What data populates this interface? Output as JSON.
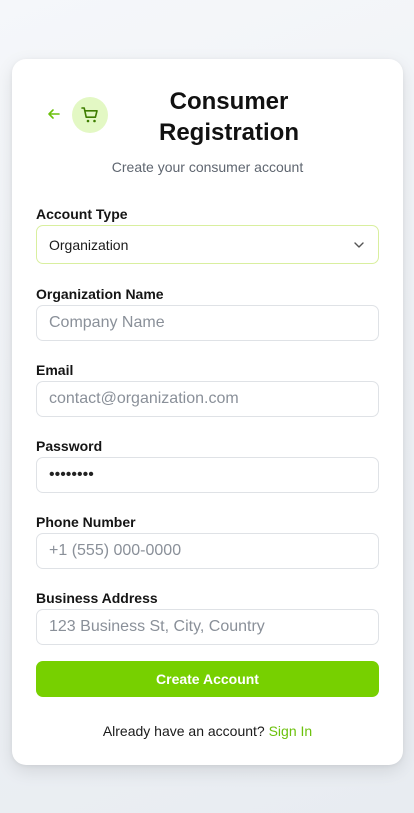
{
  "header": {
    "title": "Consumer Registration",
    "subtitle": "Create your consumer account",
    "back_icon": "arrow-left-icon",
    "logo_icon": "shopping-cart-icon",
    "accent_color": "#77d000"
  },
  "form": {
    "account_type": {
      "label": "Account Type",
      "value": "Organization"
    },
    "organization_name": {
      "label": "Organization Name",
      "placeholder": "Company Name"
    },
    "email": {
      "label": "Email",
      "placeholder": "contact@organization.com"
    },
    "password": {
      "label": "Password",
      "value": "••••••••"
    },
    "phone": {
      "label": "Phone Number",
      "placeholder": "+1 (555) 000-0000"
    },
    "address": {
      "label": "Business Address",
      "placeholder": "123 Business St, City, Country"
    },
    "submit_label": "Create Account"
  },
  "footer": {
    "prompt": "Already have an account?",
    "link": "Sign In"
  }
}
